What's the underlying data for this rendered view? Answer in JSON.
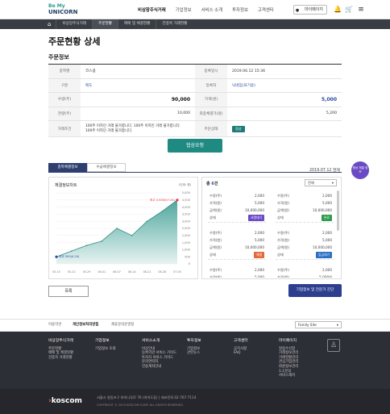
{
  "header": {
    "logo_top": "Be My",
    "logo_bottom": "UNICORN",
    "nav": [
      "비상장주식거래",
      "기업정보",
      "서비스 소개",
      "투자정보",
      "고객센터"
    ],
    "mypage": "마이페이지"
  },
  "breadcrumb": [
    "비상장주식거래",
    "주문현황",
    "매매 및 체결현황",
    "전종목 거래현황"
  ],
  "page_title": "주문현황 상세",
  "section_title": "주문정보",
  "info": {
    "labels": {
      "stock": "종목명",
      "reg_date": "등록일시",
      "type": "구분",
      "registrant": "등록자",
      "qty": "수량(주)",
      "price": "가격(원)",
      "remain": "잔량(주)",
      "min_qty": "최종체결가(원)",
      "cond": "거래조건",
      "status": "주문상태"
    },
    "stock": "코스콤",
    "reg_date": "2019.06.12 15:36",
    "type": "매도",
    "registrant": "닉네임(표기용)",
    "qty": "90,000",
    "price": "5,000",
    "remain": "10,000",
    "min_qty": "5,200",
    "cond_line1": "100주 이하인 거래 불가합니다. 100주 이하인 거래 불가합니다.",
    "cond_line2": "100주 이하인 거래 불가합니다.",
    "status": "정상"
  },
  "request_button": "협상요청",
  "tabs": [
    "종목체결정보",
    "수급체결정보"
  ],
  "as_of": "2019.07.12 현재",
  "badge": "협상 체결 정보",
  "chart_panel": {
    "title": "체결정보차트",
    "unit": "(단위: 원)",
    "max_label": "최고 4,500(07.24)",
    "min_label": "최저 500(4.24)"
  },
  "chart_data": {
    "type": "area",
    "x": [
      "05.15",
      "05.22",
      "05.29",
      "06.01",
      "06.07",
      "06.14",
      "06.21",
      "06.28",
      "07.05"
    ],
    "values": [
      500,
      900,
      1300,
      1600,
      2500,
      2000,
      3000,
      3700,
      4500
    ],
    "ylim": [
      0,
      5000
    ],
    "yticks": [
      "5,000",
      "4,500",
      "4,000",
      "3,500",
      "3,000",
      "2,500",
      "2,000",
      "1,500",
      "1,000",
      "500",
      "0"
    ]
  },
  "list_panel": {
    "count_label": "총",
    "count": "6",
    "count_suffix": "건",
    "filter": "전체",
    "labels": {
      "qty": "수량(주)",
      "price": "가격(원)",
      "amount": "금액(원)",
      "state": "상태"
    },
    "items": [
      {
        "qty": "2,000",
        "price": "5,000",
        "amount": "10,000,000",
        "state": "서명대기",
        "color": "#6a4bc4"
      },
      {
        "qty": "2,000",
        "price": "5,000",
        "amount": "10,000,000",
        "state": "완료",
        "color": "#2e9a4b"
      },
      {
        "qty": "2,000",
        "price": "5,000",
        "amount": "10,000,000",
        "state": "체결",
        "color": "#e26a3c"
      },
      {
        "qty": "2,000",
        "price": "5,000",
        "amount": "10,000,000",
        "state": "입금대기",
        "color": "#2a6fc4"
      },
      {
        "qty": "2,000",
        "price": "5,000",
        "amount": "",
        "state": "",
        "color": ""
      },
      {
        "qty": "2,000",
        "price": "5,000원",
        "amount": "",
        "state": "",
        "color": ""
      }
    ]
  },
  "list_button": "목록",
  "info_button": "기업정보 및 전문가 진단",
  "footer": {
    "links": [
      "이용약관",
      "개인정보처리방침",
      "제휴문의운영정"
    ],
    "family": "Family Site",
    "cols": [
      {
        "h": "비상장주식거래",
        "items": [
          "주문현황",
          "매매 및 체결현황",
          "전종목 거래현황"
        ]
      },
      {
        "h": "기업정보",
        "items": [
          "기업정보 조회"
        ]
      },
      {
        "h": "서비스소개",
        "items": [
          "비상안내",
          "등록약관 서비스 가이드",
          "투자자 서비스 가이드",
          "문의연락처",
          "전용계좌안내"
        ]
      },
      {
        "h": "투자정보",
        "items": [
          "기업정보",
          "관련뉴스"
        ]
      },
      {
        "h": "고객센터",
        "items": [
          "공지사항",
          "FAQ"
        ]
      },
      {
        "h": "마이페이지",
        "items": [
          "알림수신함",
          "거래정보관리",
          "거래현황관리",
          "관심기업관리",
          "회원정보관리",
          "1:1문의",
          "서비스해지"
        ]
      }
    ],
    "brand": "koscom",
    "address": "서울시 영등포구 여의나루로 76 (여의도동)  |  대표전화 02-767-7114",
    "copyright": "COPYRIGHT © 2019 KOSCOM CORP. ALL RIGHTS RESERVED"
  }
}
